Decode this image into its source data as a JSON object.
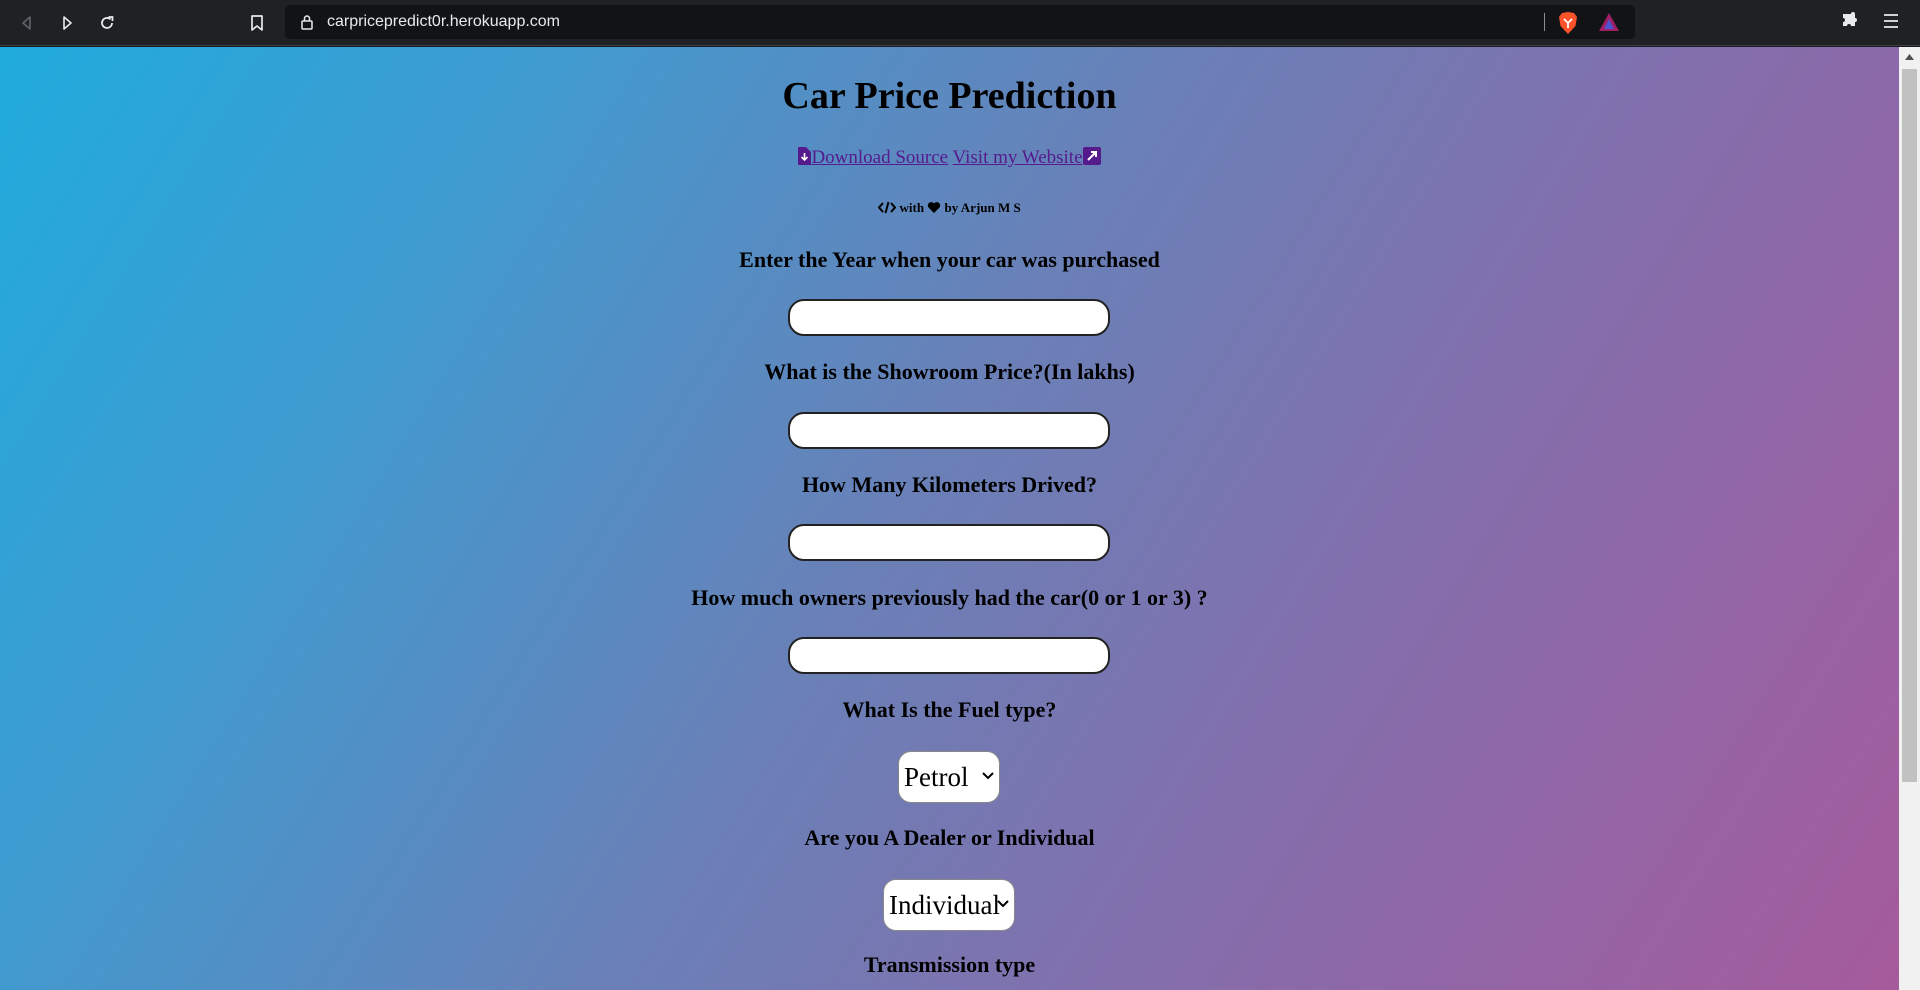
{
  "browser": {
    "url": "carpricepredict0r.herokuapp.com"
  },
  "page": {
    "title": "Car Price Prediction",
    "links": {
      "download": "Download Source",
      "website": "Visit my Website"
    },
    "credit": {
      "with": "with",
      "by": "by Arjun M S"
    },
    "form": {
      "year_label": "Enter the Year when your car was purchased",
      "year_value": "",
      "price_label": "What is the Showroom Price?(In lakhs)",
      "price_value": "",
      "km_label": "How Many Kilometers Drived?",
      "km_value": "",
      "owners_label": "How much owners previously had the car(0 or 1 or 3) ?",
      "owners_value": "",
      "fuel_label": "What Is the Fuel type?",
      "fuel_selected": "Petrol",
      "seller_label": "Are you A Dealer or Individual",
      "seller_selected": "Individual",
      "transmission_label": "Transmission type"
    }
  },
  "colors": {
    "gradient_start": "#20abdd",
    "gradient_end": "#a55b9c",
    "link": "#551a8b"
  },
  "icons": [
    "back-icon",
    "forward-icon",
    "reload-icon",
    "bookmark-icon",
    "lock-icon",
    "brave-shield-icon",
    "brave-rewards-icon",
    "extensions-icon",
    "menu-icon",
    "download-file-icon",
    "external-link-icon",
    "code-icon",
    "heart-icon"
  ]
}
